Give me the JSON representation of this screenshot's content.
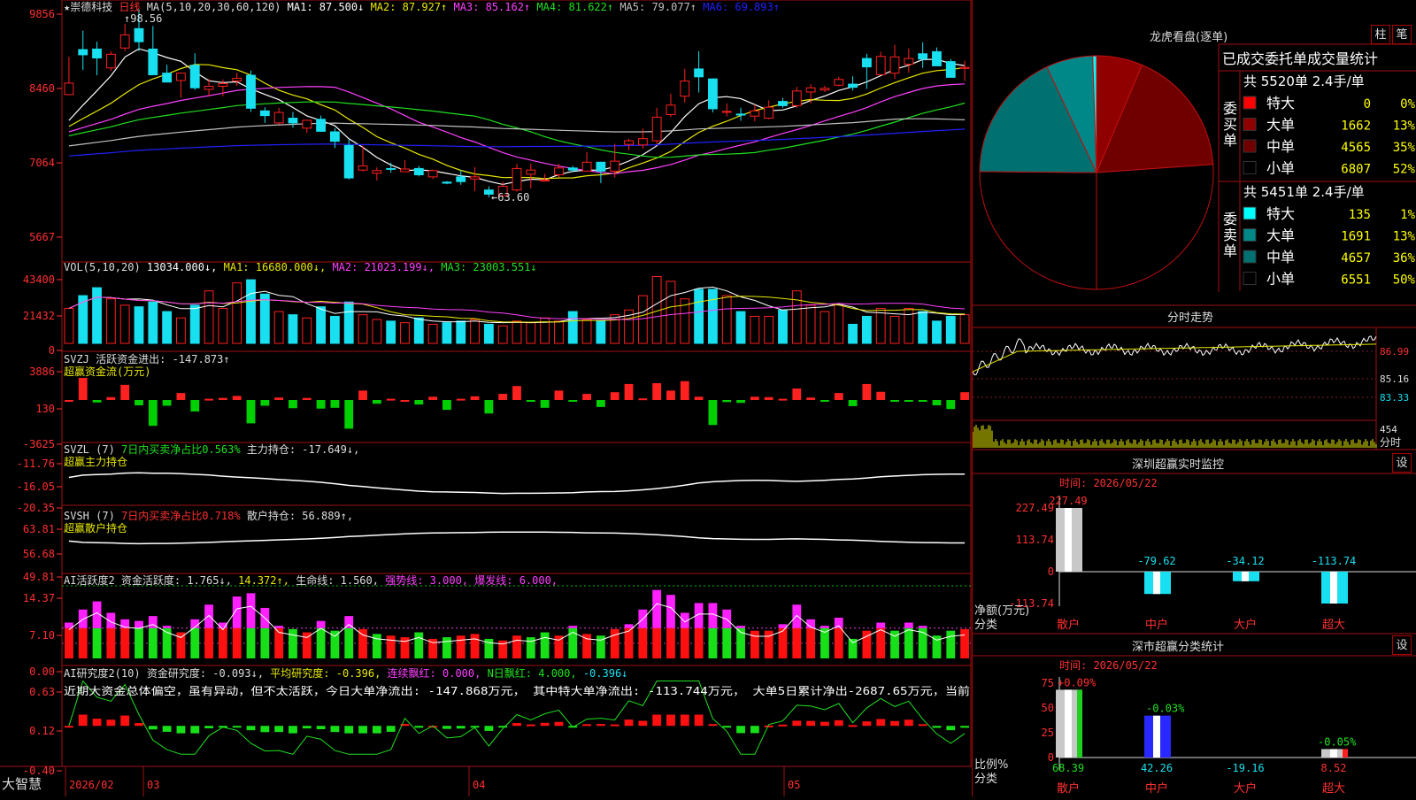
{
  "colors": {
    "up": "#ff2020",
    "down": "#18e0f0",
    "border": "#a01010",
    "ma1": "#ffffff",
    "ma2": "#e8e800",
    "ma3": "#ff40ff",
    "ma4": "#20e020",
    "ma5": "#c0c0c0",
    "ma6": "#2020ff"
  },
  "app": {
    "brand": "大智慧"
  },
  "main_panel": {
    "stock_name": "★崇德科技",
    "period": "日线",
    "ma_params": "MA(5,10,20,30,60,120)",
    "ma_values": [
      {
        "label": "MA1: 87.500",
        "arrow": "↓"
      },
      {
        "label": "MA2: 87.927",
        "arrow": "↑"
      },
      {
        "label": "MA3: 85.162",
        "arrow": "↑"
      },
      {
        "label": "MA4: 81.622",
        "arrow": "↑"
      },
      {
        "label": "MA5: 79.077",
        "arrow": "↑"
      },
      {
        "label": "MA6: 69.893",
        "arrow": "↑"
      }
    ],
    "y_ticks": [
      "9856",
      "8460",
      "7064",
      "5667"
    ],
    "high_mark": "98.56",
    "low_mark": "63.60"
  },
  "vol_panel": {
    "params": "VOL(5,10,20)",
    "value": "13034.000",
    "ma1": "MA1: 16680.000",
    "ma2": "MA2: 21023.199",
    "ma3": "MA3: 23003.551",
    "y_ticks": [
      "43400",
      "21432",
      "0"
    ]
  },
  "svzj_panel": {
    "name": "SVZJ",
    "label": "活跃资金进出: -147.873",
    "sub": "超赢资金流(万元)",
    "y_ticks": [
      "3886",
      "130",
      "-3625"
    ]
  },
  "svzl_panel": {
    "name": "SVZL (7)",
    "ratio": "7日内买卖净占比0.563%",
    "hold": "主力持仓: -17.649",
    "sub": "超赢主力持仓",
    "y_ticks": [
      "-11.76",
      "-16.05",
      "-20.35"
    ]
  },
  "svsh_panel": {
    "name": "SVSH (7)",
    "ratio": "7日内买卖净占比0.718%",
    "hold": "散户持仓: 56.889",
    "sub": "超赢散户持仓",
    "y_ticks": [
      "63.81",
      "56.68",
      "49.81"
    ]
  },
  "ai_act_panel": {
    "name": "AI活跃度2",
    "active": "资金活跃度: 1.765",
    "v2": "14.372",
    "life": "生命线: 1.560",
    "strong": "强势线: 3.000",
    "burst": "爆发线: 6.000",
    "y_ticks": [
      "14.37",
      "7.10",
      "0.00"
    ]
  },
  "ai_res_panel": {
    "name": "AI研究度2(10)",
    "res": "资金研究度: -0.093",
    "avg": "平均研究度: -0.396",
    "red": "连续飘红: 0.000",
    "nred": "N日飘红: 4.000",
    "nval": "-0.396",
    "comment": "近期大资金总体偏空，虽有异动，但不太活跃，今日大单净流出: -147.868万元， 其中特大单净流出: -113.744万元， 大单5日累计净出-2687.65万元，当前",
    "y_ticks": [
      "0.63",
      "0.12",
      "-0.40"
    ]
  },
  "x_axis": {
    "labels": [
      "2026/02",
      "03",
      "04",
      "05"
    ]
  },
  "dragon": {
    "title": "龙虎看盘(逐单)",
    "btn1": "柱",
    "btn2": "笔",
    "table_title": "已成交委托单成交量统计",
    "buy": {
      "side": "委买单",
      "total": "共 5520单 2.4手/单",
      "rows": [
        {
          "name": "特大",
          "count": "0",
          "pct": "0%",
          "color": "#ff0000"
        },
        {
          "name": "大单",
          "count": "1662",
          "pct": "13%",
          "color": "#900000"
        },
        {
          "name": "中单",
          "count": "4565",
          "pct": "35%",
          "color": "#700000"
        },
        {
          "name": "小单",
          "count": "6807",
          "pct": "52%",
          "color": "#000000"
        }
      ]
    },
    "sell": {
      "side": "委卖单",
      "total": "共 5451单 2.4手/单",
      "rows": [
        {
          "name": "特大",
          "count": "135",
          "pct": "1%",
          "color": "#00ffff"
        },
        {
          "name": "大单",
          "count": "1691",
          "pct": "13%",
          "color": "#008888"
        },
        {
          "name": "中单",
          "count": "4657",
          "pct": "36%",
          "color": "#007070"
        },
        {
          "name": "小单",
          "count": "6551",
          "pct": "50%",
          "color": "#000000"
        }
      ]
    }
  },
  "intraday": {
    "title": "分时走势",
    "y_ticks": [
      "86.99",
      "85.16",
      "83.33"
    ],
    "vol_tick": "454",
    "vol_label": "分时"
  },
  "sz_monitor": {
    "title": "深圳超赢实时监控",
    "btn": "设",
    "date": "时间: 2026/05/22",
    "y_ticks": [
      "227.49",
      "113.74",
      "0",
      "-113.74"
    ],
    "ylabel": "净额(万元)",
    "xlabel": "分类"
  },
  "sz_class": {
    "title": "深市超赢分类统计",
    "btn": "设",
    "date": "时间: 2026/05/22",
    "y_ticks": [
      "75",
      "50",
      "25",
      "0"
    ],
    "ylabel": "比例%",
    "xlabel": "分类"
  },
  "chart_data": [
    {
      "type": "candlestick",
      "title": "崇德科技 日线",
      "series_names": [
        "MA1",
        "MA2",
        "MA3",
        "MA4",
        "MA5",
        "MA6"
      ],
      "open": [
        83.2,
        91.8,
        91.9,
        88.3,
        92.1,
        95.8,
        91.9,
        87.3,
        85.9,
        88.8,
        84.2,
        84.8,
        85.8,
        86.9,
        80.1,
        77.8,
        78.7,
        76.8,
        78.5,
        76.1,
        73.5,
        68.8,
        68.2,
        69.1,
        68.5,
        69.1,
        67.5,
        66.5,
        67.5,
        67.1,
        65.0,
        63.9,
        65.0,
        68.0,
        66.7,
        67.9,
        69.2,
        68.6,
        70.3,
        68.6,
        73.7,
        73.6,
        74.4,
        79.4,
        82.9,
        88.1,
        86.2,
        80.0,
        79.5,
        79.1,
        78.7,
        81.9,
        81.1,
        83.7,
        84.1,
        85.0,
        85.2,
        90.1,
        87.0,
        87.3,
        89.0,
        91.0,
        91.4,
        89.5,
        88.2
      ],
      "high": [
        90.4,
        95.4,
        93.3,
        91.5,
        96.7,
        99.5,
        96.3,
        88.9,
        87.3,
        91.1,
        86.2,
        86.1,
        87.4,
        87.8,
        80.8,
        80.7,
        79.9,
        78.4,
        79.2,
        76.8,
        74.6,
        73.5,
        69.3,
        70.2,
        70.7,
        69.6,
        68.9,
        66.7,
        68.8,
        69.4,
        65.7,
        66.6,
        70.0,
        70.0,
        68.1,
        70.0,
        69.6,
        72.2,
        70.4,
        73.8,
        74.8,
        76.7,
        80.7,
        83.4,
        88.1,
        91.5,
        86.3,
        81.5,
        80.7,
        81.3,
        82.1,
        82.6,
        84.7,
        85.2,
        84.9,
        86.6,
        86.7,
        91.0,
        91.4,
        92.7,
        92.0,
        93.2,
        92.2,
        90.0,
        89.7
      ],
      "low": [
        83.1,
        87.9,
        86.9,
        87.7,
        91.5,
        91.5,
        87.3,
        86.6,
        82.6,
        84.1,
        82.9,
        82.9,
        84.9,
        79.9,
        77.8,
        77.5,
        76.9,
        75.9,
        76.1,
        73.0,
        67.0,
        68.5,
        66.8,
        68.3,
        68.4,
        67.6,
        67.1,
        66.1,
        66.0,
        64.8,
        63.6,
        63.8,
        64.7,
        65.3,
        66.6,
        67.4,
        68.4,
        68.5,
        66.3,
        67.4,
        72.6,
        72.9,
        73.7,
        78.9,
        81.7,
        83.6,
        79.8,
        79.0,
        78.2,
        78.1,
        78.5,
        80.7,
        80.7,
        81.5,
        83.7,
        84.8,
        84.0,
        84.3,
        86.9,
        86.2,
        87.4,
        88.3,
        89.3,
        86.7,
        85.8
      ],
      "close": [
        85.4,
        90.8,
        90.2,
        90.9,
        94.6,
        93.3,
        87.0,
        85.6,
        87.3,
        84.5,
        84.8,
        85.3,
        86.3,
        80.6,
        79.2,
        79.8,
        77.8,
        78.3,
        76.2,
        74.3,
        67.3,
        69.6,
        68.7,
        69.0,
        69.0,
        67.9,
        68.7,
        66.3,
        66.6,
        67.5,
        64.2,
        65.7,
        69.1,
        68.8,
        66.9,
        69.2,
        68.8,
        70.3,
        68.6,
        70.5,
        74.4,
        74.8,
        78.9,
        81.2,
        85.8,
        86.6,
        80.5,
        80.0,
        79.3,
        80.1,
        80.8,
        81.1,
        83.9,
        84.5,
        84.4,
        86.1,
        84.6,
        88.5,
        90.5,
        90.4,
        90.1,
        90.0,
        88.7,
        86.5,
        88.4
      ],
      "volume": [
        22000,
        30000,
        35000,
        28000,
        24000,
        23000,
        26000,
        20000,
        16000,
        24000,
        33000,
        22000,
        38000,
        40000,
        31000,
        20000,
        18000,
        16000,
        23000,
        17000,
        26000,
        18000,
        15000,
        14000,
        13000,
        16000,
        12000,
        13000,
        14000,
        15000,
        12000,
        11000,
        14000,
        13000,
        16000,
        14000,
        20000,
        15000,
        14000,
        18000,
        21000,
        30000,
        42000,
        39000,
        28000,
        34000,
        34000,
        30000,
        20000,
        17000,
        17000,
        21000,
        33000,
        24000,
        20000,
        25000,
        12000,
        17000,
        22000,
        17000,
        22000,
        20000,
        14000,
        17000,
        18000,
        13000
      ],
      "x_labels": [
        "2026/02",
        "03",
        "04",
        "05"
      ],
      "ylim": [
        56.67,
        98.56
      ]
    }
  ]
}
